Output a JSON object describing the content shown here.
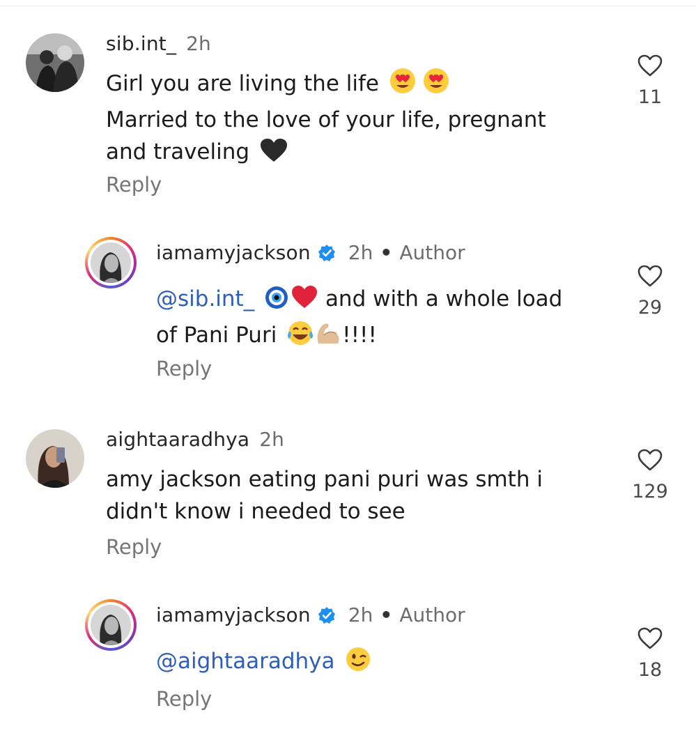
{
  "comments": [
    {
      "username": "sib.int_",
      "time": "2h",
      "lines": [
        {
          "text": "Girl you are living the life"
        },
        {
          "text": "Married to the love of your life, pregnant"
        },
        {
          "text": "and traveling"
        }
      ],
      "reply": "Reply",
      "likes": "11",
      "emojis": [
        "heart-eyes-emoji",
        "heart-eyes-emoji",
        "black-heart-emoji"
      ]
    },
    {
      "username": "iamamyjackson",
      "time": "2h",
      "dot": "•",
      "badge": "Author",
      "mention": "@sib.int_",
      "line1_rest": "and with a whole load",
      "line2": "of Pani Puri",
      "line2_end": "!!!!",
      "reply": "Reply",
      "likes": "29",
      "emojis": [
        "nazar-emoji",
        "red-heart-emoji",
        "tears-of-joy-emoji",
        "flexed-biceps-emoji"
      ]
    },
    {
      "username": "aightaaradhya",
      "time": "2h",
      "lines": [
        {
          "text": "amy jackson eating pani puri was smth i"
        },
        {
          "text": "didn't know i needed to see"
        }
      ],
      "reply": "Reply",
      "likes": "129"
    },
    {
      "username": "iamamyjackson",
      "time": "2h",
      "dot": "•",
      "badge": "Author",
      "mention": "@aightaaradhya",
      "reply": "Reply",
      "likes": "18",
      "emojis": [
        "winking-face-emoji"
      ]
    }
  ],
  "colors": {
    "mention": "#2e5fb8",
    "verified": "#1f8ef1",
    "muted": "#6c6c6c"
  }
}
